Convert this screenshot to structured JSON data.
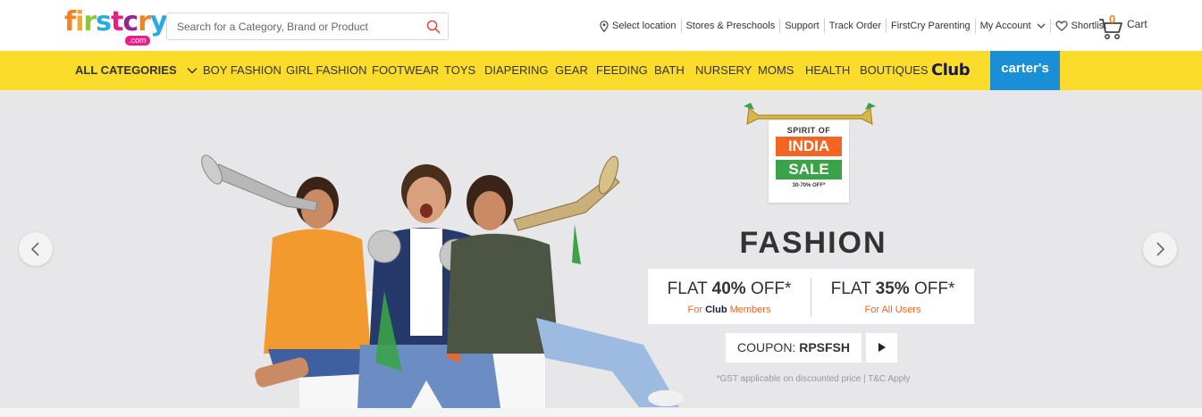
{
  "header": {
    "logo": {
      "text": "firstcry",
      "suffix": ".com"
    },
    "search": {
      "placeholder": "Search for a Category, Brand or Product"
    },
    "links": [
      {
        "label": "Select location",
        "icon": "location-pin-icon"
      },
      {
        "label": "Stores & Preschools"
      },
      {
        "label": "Support"
      },
      {
        "label": "Track Order"
      },
      {
        "label": "FirstCry Parenting"
      },
      {
        "label": "My Account",
        "icon": "chevron-down-icon"
      },
      {
        "label": "Shortlist",
        "icon": "heart-icon"
      }
    ],
    "cart": {
      "count": "0",
      "label": "Cart"
    }
  },
  "categories": {
    "all": "ALL CATEGORIES",
    "items": [
      "BOY FASHION",
      "GIRL FASHION",
      "FOOTWEAR",
      "TOYS",
      "DIAPERING",
      "GEAR",
      "FEEDING",
      "BATH",
      "NURSERY",
      "MOMS",
      "HEALTH",
      "BOUTIQUES"
    ],
    "club": "Club",
    "carters": "carter's"
  },
  "hero": {
    "badge": {
      "line1": "SPIRIT OF",
      "line2": "INDIA",
      "line3": "SALE",
      "line4": "30-70% OFF*"
    },
    "title": "FASHION",
    "offer1": {
      "prefix": "FLAT ",
      "amount": "40%",
      "suffix": " OFF*",
      "sub_prefix": "For ",
      "sub_brand": "Club",
      "sub_suffix": " Members"
    },
    "offer2": {
      "prefix": "FLAT ",
      "amount": "35%",
      "suffix": " OFF*",
      "sub": "For All Users"
    },
    "coupon": {
      "label": "COUPON: ",
      "code": "RPSFSH"
    },
    "tnc": "*GST applicable on discounted price | T&C Apply"
  },
  "colors": {
    "nav_yellow": "#fbdc2b",
    "carters_blue": "#1b8fd6",
    "accent_orange": "#f26522",
    "india_green": "#3aa349"
  }
}
